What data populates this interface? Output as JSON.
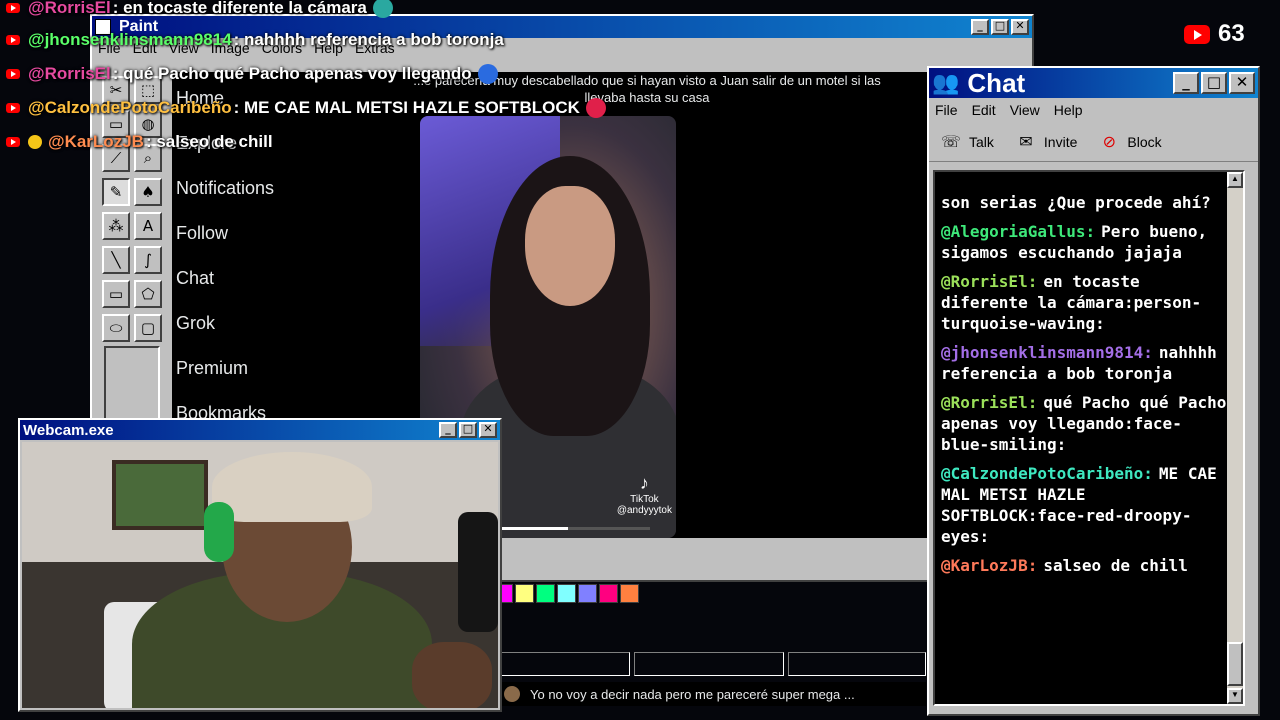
{
  "live": {
    "count": "63"
  },
  "overlay_chat": [
    {
      "user": "@RorrisEl",
      "msg": ": en tocaste diferente la cámara",
      "user_color": "#e64aa0",
      "top": 0
    },
    {
      "user": "@jhonsenklinsmann9814",
      "msg": ": nahhhh referencia a bob toronja",
      "user_color": "#5aff6a"
    },
    {
      "user": "@RorrisEl",
      "msg": ": qué Pacho qué Pacho apenas voy llegando",
      "user_color": "#e64aa0"
    },
    {
      "user": "@CalzondePotoCaribeño",
      "msg": ": ME CAE MAL METSI HAZLE SOFTBLOCK",
      "user_color": "#ffc040"
    },
    {
      "user": "@KarLozJB",
      "msg": ": salseo de chill",
      "user_color": "#ff8c50"
    }
  ],
  "paint": {
    "title": "Paint",
    "menu": [
      "File",
      "Edit",
      "View",
      "Image",
      "Colors",
      "Help",
      "Extras"
    ],
    "nav_items": [
      "Home",
      "Explore",
      "Notifications",
      "Follow",
      "Chat",
      "Grok",
      "Premium",
      "Bookmarks"
    ],
    "post_caption": "...e parecería muy descabellado que si hayan visto a Juan salir de un motel si las llevaba hasta su casa",
    "tiktok_label": "TikTok",
    "tiktok_handle": "@andyyytok",
    "video_progress": 0.45,
    "palette": [
      "#ffff00",
      "#00ff00",
      "#00ffff",
      "#0000ff",
      "#ff00ff",
      "#ffff80",
      "#00ff80",
      "#80ffff",
      "#8080ff",
      "#ff0080",
      "#ff8040"
    ],
    "reply_text": "Yo no voy a decir nada pero me pareceré super mega ..."
  },
  "chat_window": {
    "title": "Chat",
    "menu": [
      "File",
      "Edit",
      "View",
      "Help"
    ],
    "tools": {
      "talk": "Talk",
      "invite": "Invite",
      "block": "Block"
    },
    "messages": [
      {
        "user": "",
        "text": "son serias ¿Que procede ahí?",
        "color": "#ffffff"
      },
      {
        "user": "@AlegoriaGallus:",
        "text": "Pero bueno, sigamos escuchando jajaja",
        "color": "#3ee87a"
      },
      {
        "user": "@RorrisEl:",
        "text": "en tocaste diferente la cámara:person-turquoise-waving:",
        "color": "#9be05a"
      },
      {
        "user": "@jhonsenklinsmann9814:",
        "text": "nahhhh referencia a bob toronja",
        "color": "#a36ee6"
      },
      {
        "user": "@RorrisEl:",
        "text": "qué Pacho qué Pacho apenas voy llegando:face-blue-smiling:",
        "color": "#9be05a"
      },
      {
        "user": "@CalzondePotoCaribeño:",
        "text": "ME CAE MAL METSI HAZLE SOFTBLOCK:face-red-droopy-eyes:",
        "color": "#3ee8c0"
      },
      {
        "user": "@KarLozJB:",
        "text": "salseo de chill",
        "color": "#ff7a5a"
      }
    ]
  },
  "webcam": {
    "title": "Webcam.exe"
  }
}
